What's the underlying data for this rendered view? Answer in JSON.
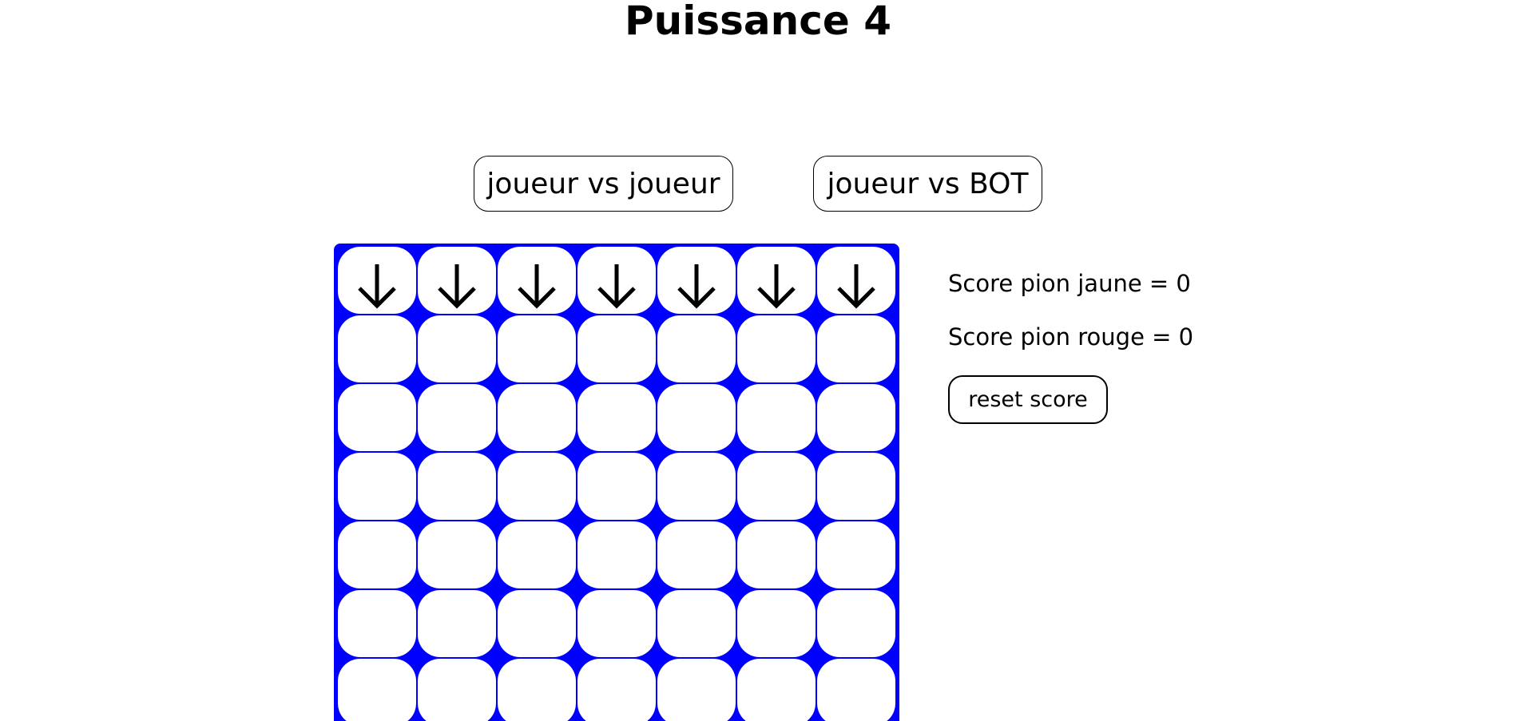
{
  "header": {
    "title": "Puissance 4"
  },
  "modes": {
    "pvp_label": "joueur vs joueur",
    "bot_label": "joueur vs BOT"
  },
  "scores": {
    "yellow_text": "Score pion jaune = 0",
    "red_text": "Score pion rouge = 0",
    "reset_label": "reset score"
  },
  "board": {
    "columns": 7,
    "visible_rows": 6,
    "drop_icon": "arrow-down-icon",
    "frame_color": "#0000ff",
    "cell_color": "#ffffff"
  }
}
